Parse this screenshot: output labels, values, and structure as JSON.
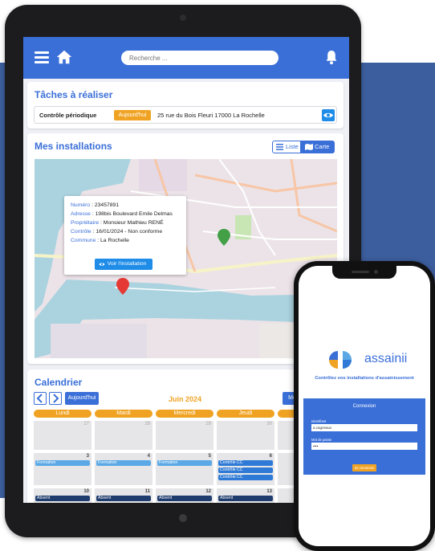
{
  "app": {
    "search": {
      "placeholder": "Recherche ..."
    },
    "icons": [
      "menu-icon",
      "home-icon",
      "bell-icon"
    ],
    "colors": {
      "primary": "#3a6fd8",
      "accent": "#f0a323",
      "background": "#3d5e9e"
    }
  },
  "tasks": {
    "title": "Tâches à réaliser",
    "row": {
      "label": "Contrôle périodique",
      "badge": "Aujourd'hui",
      "address": "25 rue du Bois Fleuri 17000 La Rochelle"
    }
  },
  "installations": {
    "title": "Mes installations",
    "view_list": "Liste",
    "view_map": "Carte",
    "selected_view": "Carte",
    "popup": {
      "numero_key": "Numéro",
      "numero_val": " : 23457891",
      "adresse_key": "Adresse",
      "adresse_val": " : 198bis Boulevard Emile Delmas",
      "proprietaire_key": "Propriétaire",
      "proprietaire_val": " : Monsieur Mathieu RENÉ",
      "controle_key": "Contrôle",
      "controle_val": " : 16/01/2024 - Non conforme",
      "commune_key": "Commune",
      "commune_val": " : La Rochelle",
      "button": "Voir l'installation"
    },
    "markers": [
      {
        "color": "#43a047",
        "label": "green-marker"
      },
      {
        "color": "#e53935",
        "label": "red-marker"
      }
    ]
  },
  "calendar": {
    "title": "Calendrier",
    "today_btn": "Aujourd'hui",
    "month": "Juin 2024",
    "view_btn": "Mo",
    "days": [
      "Lundi",
      "Mardi",
      "Mercredi",
      "Jeudi",
      ""
    ],
    "week1": [
      "27",
      "28",
      "29",
      "30"
    ],
    "week2": [
      "3",
      "4",
      "5",
      "6"
    ],
    "week3": [
      "10",
      "11",
      "12",
      "13"
    ],
    "events": {
      "formation": "Formation",
      "controle_cc": "Contrôle CC",
      "absent": "Absent"
    }
  },
  "phone": {
    "brand": "assainii",
    "tagline": "Contrôlez vos installations d'assainissement",
    "login": {
      "title": "Connexion",
      "user_label": "Identifiant",
      "user_value": "a.cagneaux",
      "pass_label": "Mot de passe",
      "pass_value": "••••",
      "submit": "Se connecter"
    }
  }
}
